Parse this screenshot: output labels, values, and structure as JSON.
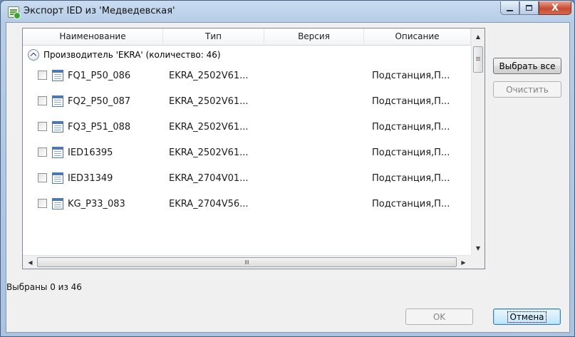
{
  "window": {
    "title": "Экспорт IED из 'Медведевская'",
    "caption_buttons": {
      "minimize": "—",
      "maximize": "□",
      "close": "X"
    }
  },
  "grid": {
    "columns": [
      "Наименование",
      "Тип",
      "Версия",
      "Описание"
    ],
    "group": {
      "label": "Производитель 'EKRA' (количество: 46)",
      "expanded": true
    },
    "rows": [
      {
        "name": "FQ1_P50_086",
        "type": "EKRA_2502V61...",
        "version": "",
        "description": "Подстанция,П...",
        "checked": false
      },
      {
        "name": "FQ2_P50_087",
        "type": "EKRA_2502V61...",
        "version": "",
        "description": "Подстанция,П...",
        "checked": false
      },
      {
        "name": "FQ3_P51_088",
        "type": "EKRA_2502V61...",
        "version": "",
        "description": "Подстанция,П...",
        "checked": false
      },
      {
        "name": "IED16395",
        "type": "EKRA_2502V61...",
        "version": "",
        "description": "Подстанция,П...",
        "checked": false
      },
      {
        "name": "IED31349",
        "type": "EKRA_2704V01...",
        "version": "",
        "description": "Подстанция,П...",
        "checked": false
      },
      {
        "name": "KG_P33_083",
        "type": "EKRA_2704V56...",
        "version": "",
        "description": "Подстанция,П...",
        "checked": false
      }
    ],
    "vscroll": {
      "up": "▲",
      "down": "▼"
    },
    "hscroll": {
      "left": "◀",
      "right": "▶"
    }
  },
  "buttons": {
    "select_all": "Выбрать все",
    "clear": "Очистить",
    "ok": "OK",
    "cancel": "Отмена"
  },
  "status": "Выбраны 0 из 46"
}
